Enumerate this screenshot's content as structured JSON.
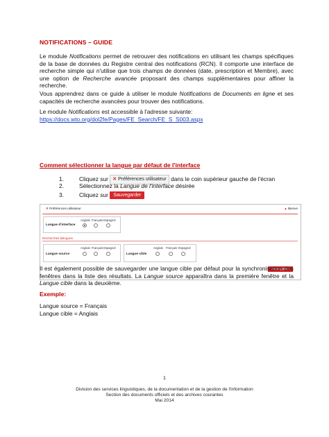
{
  "title": "NOTIFICATIONS – GUIDE",
  "intro": {
    "p1_pre": "Le module ",
    "p1_em1": "Notifications",
    "p1_post": " permet de retrouver des notifications en utilisant les champs spécifiques de la base de données du Registre central des notifications (RCN). Il comporte une interface de recherche simple qui n'utilise que trois champs de données (date, prescription et Membre), avec une option de ",
    "p1_em2": "Recherche avancée",
    "p1_end": " proposant des champs supplémentaires pour affiner la recherche.",
    "p2_pre": "Vous apprendrez dans ce guide à utiliser le module ",
    "p2_em1": "Notifications",
    "p2_mid": " de ",
    "p2_em2": "Documents en ligne",
    "p2_end": " et ses capacités de recherche avancées pour trouver des notifications.",
    "p3_pre": "Le module ",
    "p3_em": "Notifications",
    "p3_end": " est accessible à l'adresse suivante:",
    "url": "https://docs.wto.org/dol2fe/Pages/FE_Search/FE_S_S003.aspx"
  },
  "section_title": "Comment sélectionner la langue par défaut de l'interface",
  "steps": [
    {
      "num": "1.",
      "pre": "Cliquez sur",
      "button": "Préférences utilisateur",
      "post": "dans le coin supérieur gauche de l'écran"
    },
    {
      "num": "2.",
      "pre": "Sélectionnez la ",
      "em": "Langue de l'interface",
      "post": " désirée"
    },
    {
      "num": "3.",
      "pre": "Cliquez sur",
      "button": "Sauvegarder"
    }
  ],
  "screenshot": {
    "header_title": "Préférences utilisateur",
    "header_right": "Bienve",
    "interface_label": "Langue d'interface",
    "languages": [
      "Anglais",
      "Français",
      "Espagnol"
    ],
    "section_label": "Recherches bilingues",
    "source_label": "Langue source",
    "target_label": "Langue cible",
    "save_label": "Sauvegarder"
  },
  "para_after_pre": "Il est également possible de sauvegarder une langue cible par défaut pour la synchronisation des fenêtres dans la liste des résultats. La ",
  "para_after_em1": "Langue source",
  "para_after_mid": " apparaîtra dans la première fenêtre et la ",
  "para_after_em2": "Langue cible",
  "para_after_end": " dans la deuxième.",
  "example_title": "Exemple:",
  "example_lines": [
    "Langue source = Français",
    "Langue cible = Anglais"
  ],
  "page_number": "1",
  "footer_lines": [
    "Division des services linguistiques, de la documentation et de la gestion de l'information",
    "Section des documents officiels et des archives courantes",
    "Mai 2014"
  ]
}
